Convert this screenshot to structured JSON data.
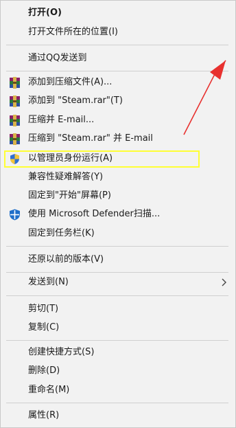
{
  "menu": {
    "items": [
      {
        "label": "打开(O)",
        "bold": true
      },
      {
        "label": "打开文件所在的位置(I)"
      },
      {
        "label": "通过QQ发送到"
      },
      {
        "label": "添加到压缩文件(A)..."
      },
      {
        "label": "添加到 \"Steam.rar\"(T)"
      },
      {
        "label": "压缩并 E-mail..."
      },
      {
        "label": "压缩到 \"Steam.rar\" 并 E-mail"
      },
      {
        "label": "以管理员身份运行(A)"
      },
      {
        "label": "兼容性疑难解答(Y)"
      },
      {
        "label": "固定到\"开始\"屏幕(P)"
      },
      {
        "label": "使用 Microsoft Defender扫描..."
      },
      {
        "label": "固定到任务栏(K)"
      },
      {
        "label": "还原以前的版本(V)"
      },
      {
        "label": "发送到(N)"
      },
      {
        "label": "剪切(T)"
      },
      {
        "label": "复制(C)"
      },
      {
        "label": "创建快捷方式(S)"
      },
      {
        "label": "删除(D)"
      },
      {
        "label": "重命名(M)"
      },
      {
        "label": "属性(R)"
      }
    ]
  },
  "colors": {
    "menu_bg": "#f2f2f2",
    "highlight_box": "#ffff33",
    "annotation_arrow": "#e8312f"
  },
  "icons": {
    "winrar": "winrar-icon",
    "uac_shield": "uac-shield-icon",
    "defender": "defender-shield-icon",
    "submenu": "chevron-right-icon"
  }
}
